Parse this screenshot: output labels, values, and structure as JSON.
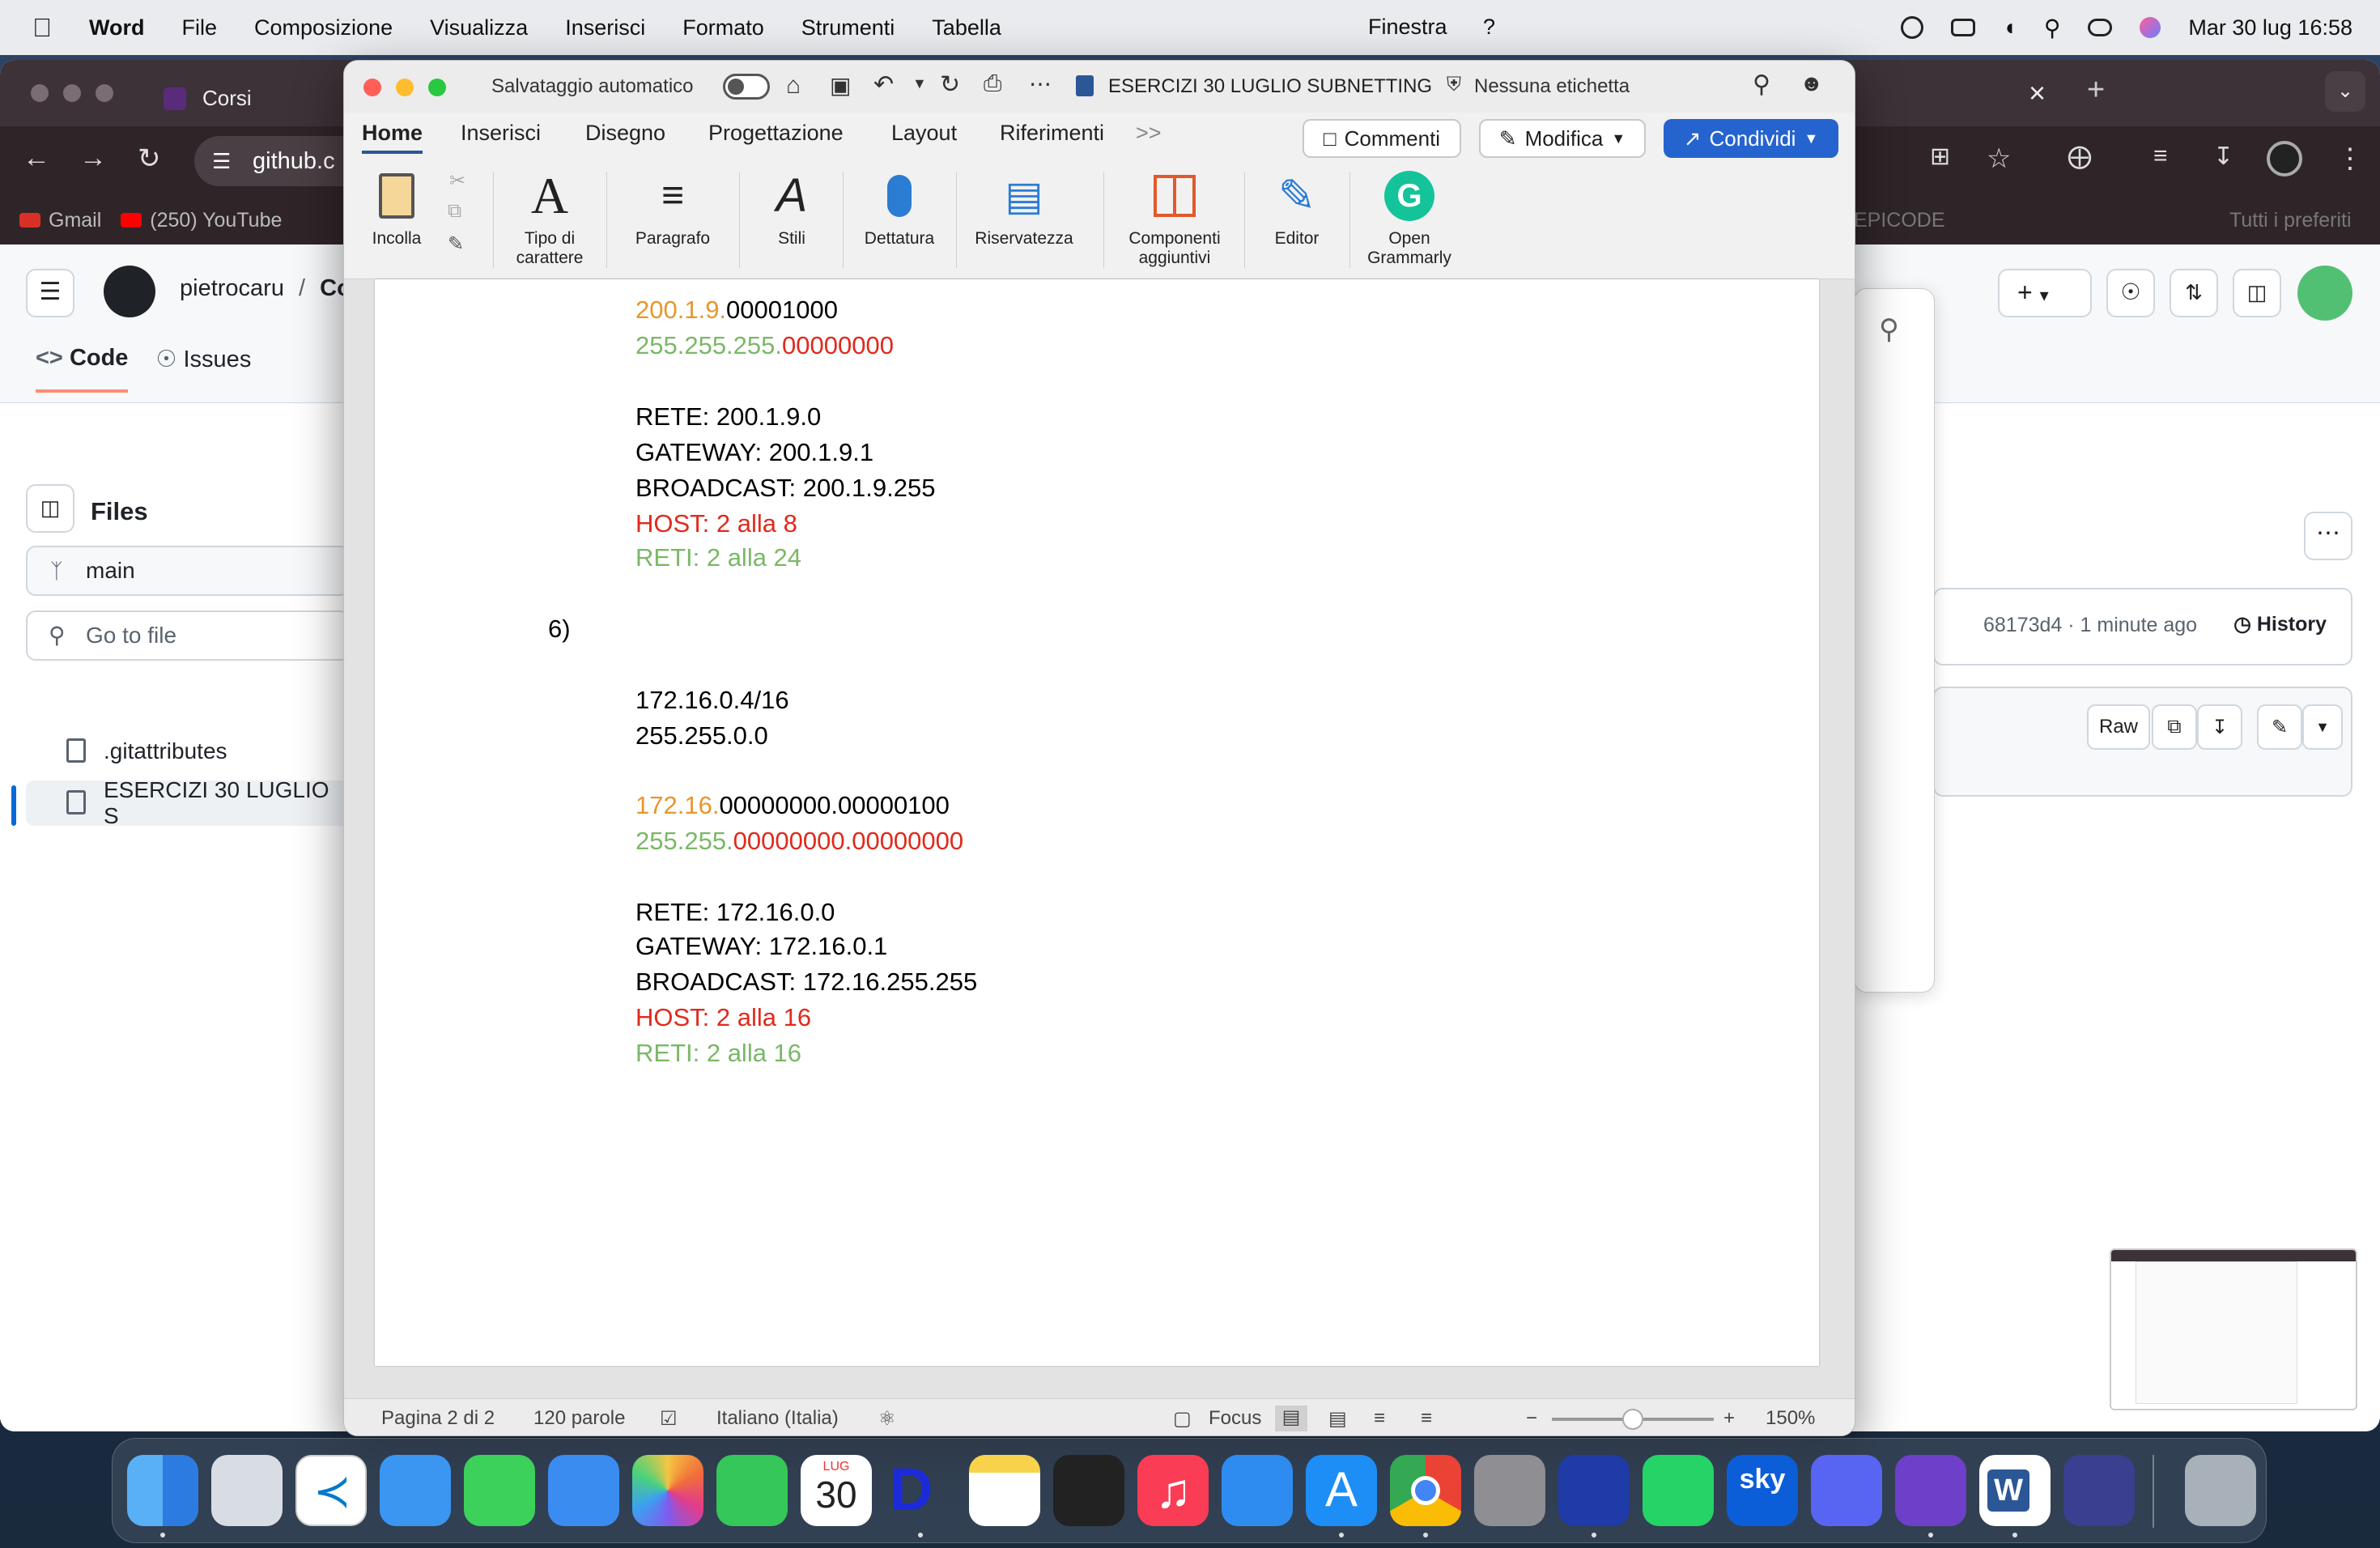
{
  "menubar": {
    "app": "Word",
    "items": [
      "File",
      "Composizione",
      "Visualizza",
      "Inserisci",
      "Formato",
      "Strumenti",
      "Tabella"
    ],
    "center_items": [
      "Finestra",
      "?"
    ],
    "datetime": "Mar 30 lug  16:58"
  },
  "chrome": {
    "tab_title": "Corsi",
    "url": "github.c",
    "bookmarks": [
      "Gmail",
      "(250) YouTube"
    ],
    "bookmarks_right": [
      "EPICODE",
      "Tutti i preferiti"
    ]
  },
  "github": {
    "path_owner": "pietrocaru",
    "path_sep": "/",
    "path_repo": "Co",
    "tabs": [
      "Code",
      "Issues"
    ],
    "files_title": "Files",
    "branch": "main",
    "go_to_file": "Go to file",
    "files": [
      ".gitattributes",
      "ESERCIZI 30 LUGLIO S"
    ],
    "commit_meta": "68173d4 · 1 minute ago",
    "history": "History",
    "raw": "Raw"
  },
  "word": {
    "autosave_label": "Salvataggio automatico",
    "doc_title": "ESERCIZI 30 LUGLIO SUBNETTING",
    "label_status": "Nessuna etichetta",
    "tabs": [
      "Home",
      "Inserisci",
      "Disegno",
      "Progettazione",
      "Layout",
      "Riferimenti"
    ],
    "more_tabs": ">>",
    "comments_btn": "Commenti",
    "edit_btn": "Modifica",
    "share_btn": "Condividi",
    "ribbon": {
      "paste": "Incolla",
      "font_1": "Tipo di",
      "font_2": "carattere",
      "paragraph": "Paragrafo",
      "styles": "Stili",
      "dictation": "Dettatura",
      "privacy": "Riservatezza",
      "addins_1": "Componenti",
      "addins_2": "aggiuntivi",
      "editor": "Editor",
      "grammarly_1": "Open",
      "grammarly_2": "Grammarly"
    },
    "doc": {
      "s5_bin1_a": "200.1.9.",
      "s5_bin1_b": "00001000",
      "s5_bin2_a": "255.255.255.",
      "s5_bin2_b": "00000000",
      "s5_rete": "RETE: 200.1.9.0",
      "s5_gateway": "GATEWAY: 200.1.9.1",
      "s5_broadcast": "BROADCAST: 200.1.9.255",
      "s5_host": "HOST: 2 alla 8",
      "s5_reti": "RETI: 2 alla 24",
      "s6_number": "6)",
      "s6_ip": "172.16.0.4/16",
      "s6_mask": "255.255.0.0",
      "s6_bin1_a": "172.16.",
      "s6_bin1_b": "00000000.00000100",
      "s6_bin2_a": "255.255.",
      "s6_bin2_b": "00000000.00000000",
      "s6_rete": "RETE: 172.16.0.0",
      "s6_gateway": "GATEWAY: 172.16.0.1",
      "s6_broadcast": "BROADCAST: 172.16.255.255",
      "s6_host": "HOST: 2 alla 16",
      "s6_reti": "RETI: 2 alla 16"
    },
    "status": {
      "page": "Pagina 2 di 2",
      "words": "120 parole",
      "language": "Italiano (Italia)",
      "focus": "Focus",
      "zoom": "150%",
      "zoom_fraction": 0.5
    }
  },
  "dock": {
    "calendar_month": "LUG",
    "calendar_day": "30",
    "sky_label": "sky"
  },
  "colors": {
    "orange_text": "#e8962b",
    "green_text": "#7ab866",
    "red_text": "#e02a1c",
    "share_blue": "#2564cf"
  }
}
